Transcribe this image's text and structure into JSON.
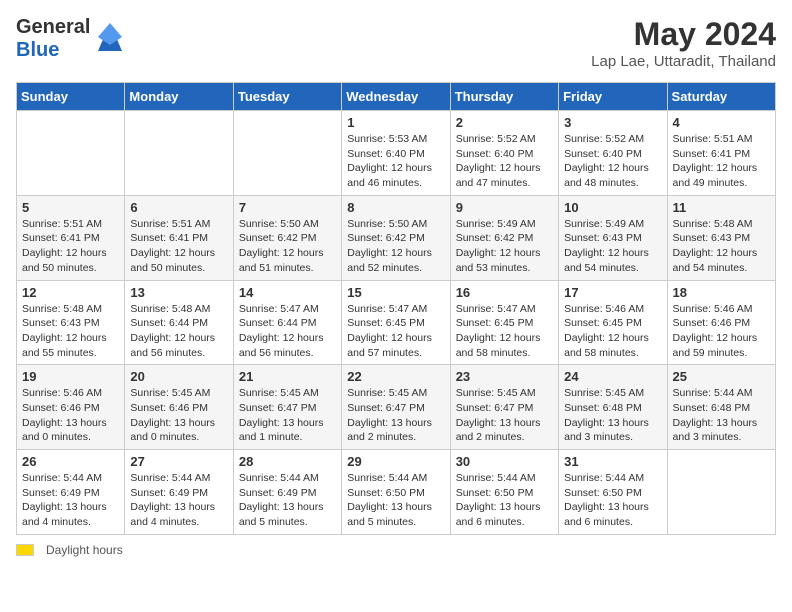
{
  "header": {
    "logo_line1": "General",
    "logo_line2": "Blue",
    "month_title": "May 2024",
    "location": "Lap Lae, Uttaradit, Thailand"
  },
  "days_of_week": [
    "Sunday",
    "Monday",
    "Tuesday",
    "Wednesday",
    "Thursday",
    "Friday",
    "Saturday"
  ],
  "weeks": [
    [
      {
        "day": "",
        "info": ""
      },
      {
        "day": "",
        "info": ""
      },
      {
        "day": "",
        "info": ""
      },
      {
        "day": "1",
        "info": "Sunrise: 5:53 AM\nSunset: 6:40 PM\nDaylight: 12 hours and 46 minutes."
      },
      {
        "day": "2",
        "info": "Sunrise: 5:52 AM\nSunset: 6:40 PM\nDaylight: 12 hours and 47 minutes."
      },
      {
        "day": "3",
        "info": "Sunrise: 5:52 AM\nSunset: 6:40 PM\nDaylight: 12 hours and 48 minutes."
      },
      {
        "day": "4",
        "info": "Sunrise: 5:51 AM\nSunset: 6:41 PM\nDaylight: 12 hours and 49 minutes."
      }
    ],
    [
      {
        "day": "5",
        "info": "Sunrise: 5:51 AM\nSunset: 6:41 PM\nDaylight: 12 hours and 50 minutes."
      },
      {
        "day": "6",
        "info": "Sunrise: 5:51 AM\nSunset: 6:41 PM\nDaylight: 12 hours and 50 minutes."
      },
      {
        "day": "7",
        "info": "Sunrise: 5:50 AM\nSunset: 6:42 PM\nDaylight: 12 hours and 51 minutes."
      },
      {
        "day": "8",
        "info": "Sunrise: 5:50 AM\nSunset: 6:42 PM\nDaylight: 12 hours and 52 minutes."
      },
      {
        "day": "9",
        "info": "Sunrise: 5:49 AM\nSunset: 6:42 PM\nDaylight: 12 hours and 53 minutes."
      },
      {
        "day": "10",
        "info": "Sunrise: 5:49 AM\nSunset: 6:43 PM\nDaylight: 12 hours and 54 minutes."
      },
      {
        "day": "11",
        "info": "Sunrise: 5:48 AM\nSunset: 6:43 PM\nDaylight: 12 hours and 54 minutes."
      }
    ],
    [
      {
        "day": "12",
        "info": "Sunrise: 5:48 AM\nSunset: 6:43 PM\nDaylight: 12 hours and 55 minutes."
      },
      {
        "day": "13",
        "info": "Sunrise: 5:48 AM\nSunset: 6:44 PM\nDaylight: 12 hours and 56 minutes."
      },
      {
        "day": "14",
        "info": "Sunrise: 5:47 AM\nSunset: 6:44 PM\nDaylight: 12 hours and 56 minutes."
      },
      {
        "day": "15",
        "info": "Sunrise: 5:47 AM\nSunset: 6:45 PM\nDaylight: 12 hours and 57 minutes."
      },
      {
        "day": "16",
        "info": "Sunrise: 5:47 AM\nSunset: 6:45 PM\nDaylight: 12 hours and 58 minutes."
      },
      {
        "day": "17",
        "info": "Sunrise: 5:46 AM\nSunset: 6:45 PM\nDaylight: 12 hours and 58 minutes."
      },
      {
        "day": "18",
        "info": "Sunrise: 5:46 AM\nSunset: 6:46 PM\nDaylight: 12 hours and 59 minutes."
      }
    ],
    [
      {
        "day": "19",
        "info": "Sunrise: 5:46 AM\nSunset: 6:46 PM\nDaylight: 13 hours and 0 minutes."
      },
      {
        "day": "20",
        "info": "Sunrise: 5:45 AM\nSunset: 6:46 PM\nDaylight: 13 hours and 0 minutes."
      },
      {
        "day": "21",
        "info": "Sunrise: 5:45 AM\nSunset: 6:47 PM\nDaylight: 13 hours and 1 minute."
      },
      {
        "day": "22",
        "info": "Sunrise: 5:45 AM\nSunset: 6:47 PM\nDaylight: 13 hours and 2 minutes."
      },
      {
        "day": "23",
        "info": "Sunrise: 5:45 AM\nSunset: 6:47 PM\nDaylight: 13 hours and 2 minutes."
      },
      {
        "day": "24",
        "info": "Sunrise: 5:45 AM\nSunset: 6:48 PM\nDaylight: 13 hours and 3 minutes."
      },
      {
        "day": "25",
        "info": "Sunrise: 5:44 AM\nSunset: 6:48 PM\nDaylight: 13 hours and 3 minutes."
      }
    ],
    [
      {
        "day": "26",
        "info": "Sunrise: 5:44 AM\nSunset: 6:49 PM\nDaylight: 13 hours and 4 minutes."
      },
      {
        "day": "27",
        "info": "Sunrise: 5:44 AM\nSunset: 6:49 PM\nDaylight: 13 hours and 4 minutes."
      },
      {
        "day": "28",
        "info": "Sunrise: 5:44 AM\nSunset: 6:49 PM\nDaylight: 13 hours and 5 minutes."
      },
      {
        "day": "29",
        "info": "Sunrise: 5:44 AM\nSunset: 6:50 PM\nDaylight: 13 hours and 5 minutes."
      },
      {
        "day": "30",
        "info": "Sunrise: 5:44 AM\nSunset: 6:50 PM\nDaylight: 13 hours and 6 minutes."
      },
      {
        "day": "31",
        "info": "Sunrise: 5:44 AM\nSunset: 6:50 PM\nDaylight: 13 hours and 6 minutes."
      },
      {
        "day": "",
        "info": ""
      }
    ]
  ],
  "footer": {
    "daylight_label": "Daylight hours"
  }
}
